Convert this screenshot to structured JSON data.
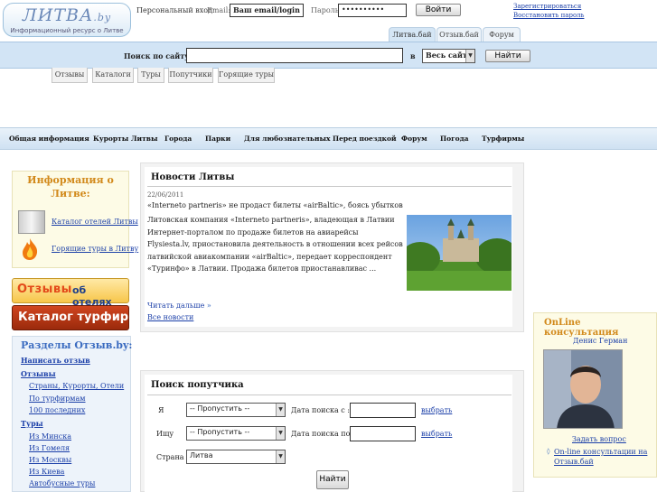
{
  "logo": {
    "name": "ЛИТВА",
    "domain": ".by",
    "subtitle": "Информационный ресурс о Литве"
  },
  "login": {
    "label": "Персональный вход:",
    "email_label": "Email:",
    "email_value": "Ваш email/login",
    "password_label": "Пароль:",
    "password_value": "••••••••••",
    "submit": "Войти",
    "register": "Зарегистрироваться",
    "restore": "Восстановить пароль"
  },
  "site_tabs": [
    "Литва.бай",
    "Отзыв.бай",
    "Форум"
  ],
  "search": {
    "label": "Поиск по сайту:",
    "in_label": "в",
    "scope": "Весь сайт",
    "button": "Найти"
  },
  "sub_tabs": [
    "Отзывы",
    "Каталоги",
    "Туры",
    "Попутчики",
    "Горящие туры"
  ],
  "nav": [
    "Общая информация",
    "Курорты Литвы",
    "Города",
    "Парки",
    "Для любознательных",
    "Перед поездкой",
    "Форум",
    "Погода",
    "Турфирмы"
  ],
  "info": {
    "title": "Информация о Литве:",
    "links": [
      "Каталог отелей Литвы",
      "Горящие туры в Литву"
    ]
  },
  "banners": {
    "reviews": {
      "word1": "Отзывы",
      "word2": "об отелях"
    },
    "catalog": "Каталог турфирм"
  },
  "sections": {
    "title": "Разделы Отзыв.by:",
    "write": "Написать отзыв",
    "reviews_h": "Отзывы",
    "reviews": [
      "Страны, Курорты, Отели",
      "По турфирмам",
      "100 последних"
    ],
    "tours_h": "Туры",
    "tours": [
      "Из Минска",
      "Из Гомеля",
      "Из Москвы",
      "Из Киева",
      "Автобусные туры"
    ]
  },
  "news": {
    "title": "Новости Литвы",
    "date": "22/06/2011",
    "headline": "«Internetо partneris» не продаст билеты «airBaltic», боясь убытков",
    "body": "Литовская компания «Internetо partneris», владеющая в Латвии Интернет-порталом по продаже билетов на авиарейсы Flysiesta.lv, приостановила деятельность в отношении всех рейсов латвийской авиакомпании «airBaltic», передает корреспондент «Туринфо» в Латвии. Продажа билетов приостанавливас ...",
    "more": "Читать дальше",
    "all": "Все новости"
  },
  "poputchik": {
    "title": "Поиск попутчика",
    "rows": [
      {
        "label": "Я",
        "select": "-- Пропустить --",
        "date_label": "Дата поиска с :",
        "pick": "выбрать"
      },
      {
        "label": "Ищу",
        "select": "-- Пропустить --",
        "date_label": "Дата поиска по:",
        "pick": "выбрать"
      }
    ],
    "country_label": "Страна",
    "country": "Литва",
    "button": "Найти"
  },
  "consult": {
    "title": "OnLine консультация",
    "name": "Денис Герман",
    "ask": "Задать вопрос",
    "link": "On-line консультации на Отзыв.бай"
  },
  "colors": {
    "accent": "#d28a1c",
    "link": "#1b3fa8",
    "band": "#d2e4f5"
  }
}
